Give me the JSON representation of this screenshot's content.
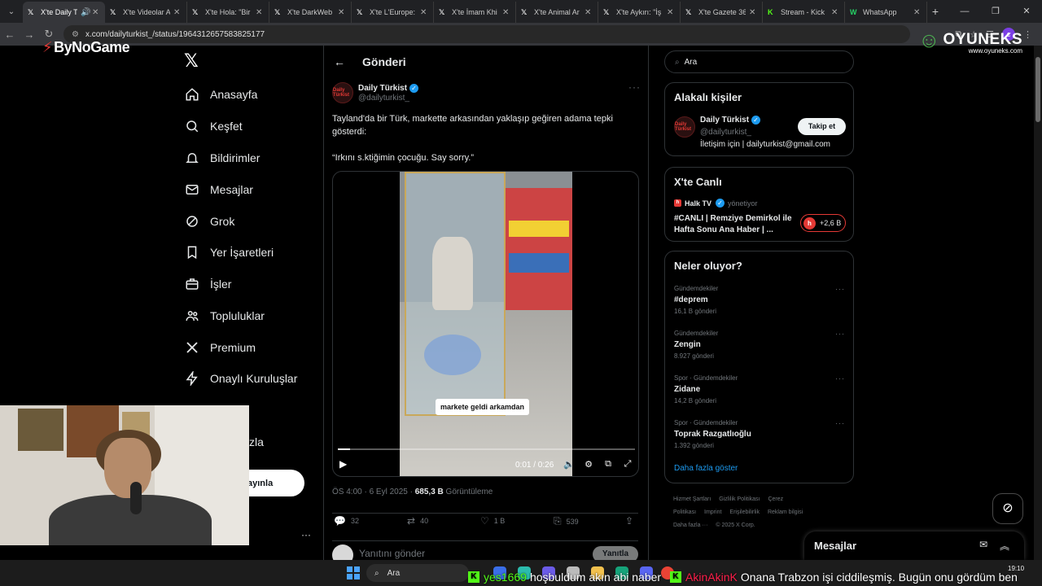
{
  "browser": {
    "tabs": [
      {
        "title": "X'te Daily T",
        "favicon": "X",
        "active": true,
        "muted_icon": "speaker-icon"
      },
      {
        "title": "X'te Videolar A",
        "favicon": "X"
      },
      {
        "title": "X'te Hola: \"Bir",
        "favicon": "X"
      },
      {
        "title": "X'te DarkWeb",
        "favicon": "X"
      },
      {
        "title": "X'te L'Europe:",
        "favicon": "X"
      },
      {
        "title": "X'te İmam Khi",
        "favicon": "X"
      },
      {
        "title": "X'te Animal Ar",
        "favicon": "X"
      },
      {
        "title": "X'te Aykırı: \"İş",
        "favicon": "X"
      },
      {
        "title": "X'te Gazete 36",
        "favicon": "X"
      },
      {
        "title": "Stream - Kick",
        "favicon": "K"
      },
      {
        "title": "WhatsApp",
        "favicon": "W"
      }
    ],
    "url": "x.com/dailyturkist_/status/1964312657583825177"
  },
  "overlays": {
    "bynogame": "ByNoGame",
    "oyuneks": "OYUNEKS",
    "oyuneks_site": "www.oyuneks.com"
  },
  "nav": {
    "items": [
      {
        "label": "Anasayfa",
        "icon": "home-icon"
      },
      {
        "label": "Keşfet",
        "icon": "search-icon"
      },
      {
        "label": "Bildirimler",
        "icon": "bell-icon"
      },
      {
        "label": "Mesajlar",
        "icon": "mail-icon"
      },
      {
        "label": "Grok",
        "icon": "grok-icon"
      },
      {
        "label": "Yer İşaretleri",
        "icon": "bookmark-icon"
      },
      {
        "label": "İşler",
        "icon": "briefcase-icon"
      },
      {
        "label": "Topluluklar",
        "icon": "communities-icon"
      },
      {
        "label": "Premium",
        "icon": "x-icon"
      },
      {
        "label": "Onaylı Kuruluşlar",
        "icon": "lightning-icon"
      }
    ],
    "more_partial": "zla",
    "post_partial": "ayınla"
  },
  "post": {
    "header": "Gönderi",
    "author_name": "Daily Türkist",
    "author_handle": "@dailyturkist_",
    "avatar_text": "Daily Türkist",
    "text_line1": "Tayland'da bir Türk, markette arkasından yaklaşıp geğiren adama tepki gösterdi:",
    "text_line2": "“Irkını s.ktiğimin çocuğu. Say sorry.”",
    "video": {
      "caption": "markete geldi arkamdan",
      "time": "0:01 / 0:26",
      "progress": 0.04
    },
    "time": "ÖS 4:00 · 6 Eyl 2025 ·",
    "views": "685,3 B",
    "views_label": "Görüntüleme",
    "stats": {
      "replies": "32",
      "reposts": "40",
      "likes": "1 B",
      "bookmarks": "539"
    },
    "reply_placeholder": "Yanıtını gönder",
    "reply_button": "Yanıtla"
  },
  "sidebar": {
    "search_placeholder": "Ara",
    "related_title": "Alakalı kişiler",
    "related": {
      "name": "Daily Türkist",
      "handle": "@dailyturkist_",
      "bio": "İletişim için | dailyturkist@gmail.com",
      "follow": "Takip et"
    },
    "live_title": "X'te Canlı",
    "live": {
      "source": "Halk TV",
      "role": "yönetiyor",
      "title": "#CANLI | Remziye Demirkol ile Hafta Sonu Ana Haber | ...",
      "count": "+2,6 B"
    },
    "trends_title": "Neler oluyor?",
    "trends": [
      {
        "category": "Gündemdekiler",
        "name": "#deprem",
        "count": "16,1 B gönderi"
      },
      {
        "category": "Gündemdekiler",
        "name": "Zengin",
        "count": "8.927 gönderi"
      },
      {
        "category": "Spor · Gündemdekiler",
        "name": "Zidane",
        "count": "14,2 B gönderi"
      },
      {
        "category": "Spor · Gündemdekiler",
        "name": "Toprak Razgatlıoğlu",
        "count": "1.392 gönderi"
      }
    ],
    "show_more": "Daha fazla göster",
    "footer": {
      "links": [
        "Hizmet Şartları",
        "Gizlilik Politikası",
        "Çerez Politikası",
        "Imprint",
        "Erişilebilirlik",
        "Reklam bilgisi"
      ],
      "more": "Daha fazla ···",
      "copyright": "© 2025 X Corp."
    }
  },
  "messages_drawer": {
    "title": "Mesajlar"
  },
  "taskbar": {
    "search": "Ara",
    "time": "19:10"
  },
  "chat": [
    {
      "user": "yes1669",
      "message": "hoşbuldum akın abi naber"
    },
    {
      "user": "AkinAkinK",
      "message": "Onana Trabzon işi ciddileşmiş. Bugün onu gördüm ben"
    }
  ]
}
